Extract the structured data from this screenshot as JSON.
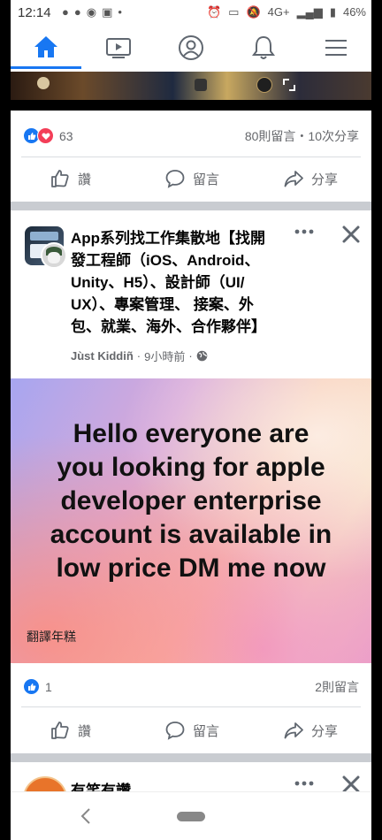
{
  "status_bar": {
    "time": "12:14",
    "left_icons": [
      "android-icon",
      "chat-bubble-icon",
      "message-icon",
      "screenshot-icon",
      "dot-icon"
    ],
    "right_icons": [
      "alarm-icon",
      "cast-icon",
      "mute-icon",
      "signal-icon",
      "battery-icon"
    ],
    "network": "4G+",
    "battery": "46%"
  },
  "nav": {
    "tabs": [
      {
        "name": "home",
        "icon": "home-icon",
        "active": true
      },
      {
        "name": "watch",
        "icon": "video-icon",
        "active": false
      },
      {
        "name": "profile",
        "icon": "profile-icon",
        "active": false
      },
      {
        "name": "notifications",
        "icon": "bell-icon",
        "active": false
      },
      {
        "name": "menu",
        "icon": "hamburger-icon",
        "active": false
      }
    ],
    "accent": "#1877f2"
  },
  "post1": {
    "reaction_count": "63",
    "comments_shares": "80則留言・10次分享",
    "actions": {
      "like": "讚",
      "comment": "留言",
      "share": "分享"
    }
  },
  "post2": {
    "group_name": "App系列找工作集散地【找開發工程師（iOS、Android、Unity、H5）、設計師（UI/UX）、專案管理、 接案、外包、就業、海外、合作夥伴】",
    "title_lines": [
      "App系列找工作集散地【找開",
      "發工程師（iOS、Android、",
      "Unity、H5）、設計師（UI/",
      "UX）、專案管理、 接案、外",
      "包、就業、海外、合作夥伴】"
    ],
    "author": "Jùst Kiddiñ",
    "time": "9小時前",
    "banner_lines": [
      "Hello everyone are",
      "you looking for apple",
      "developer enterprise",
      "account is available in",
      "low price DM me now"
    ],
    "translate": "翻譯年糕",
    "reaction_count": "1",
    "comments": "2則留言",
    "actions": {
      "like": "讚",
      "comment": "留言",
      "share": "分享"
    }
  },
  "post3": {
    "title_partial": "有笑有讚"
  }
}
